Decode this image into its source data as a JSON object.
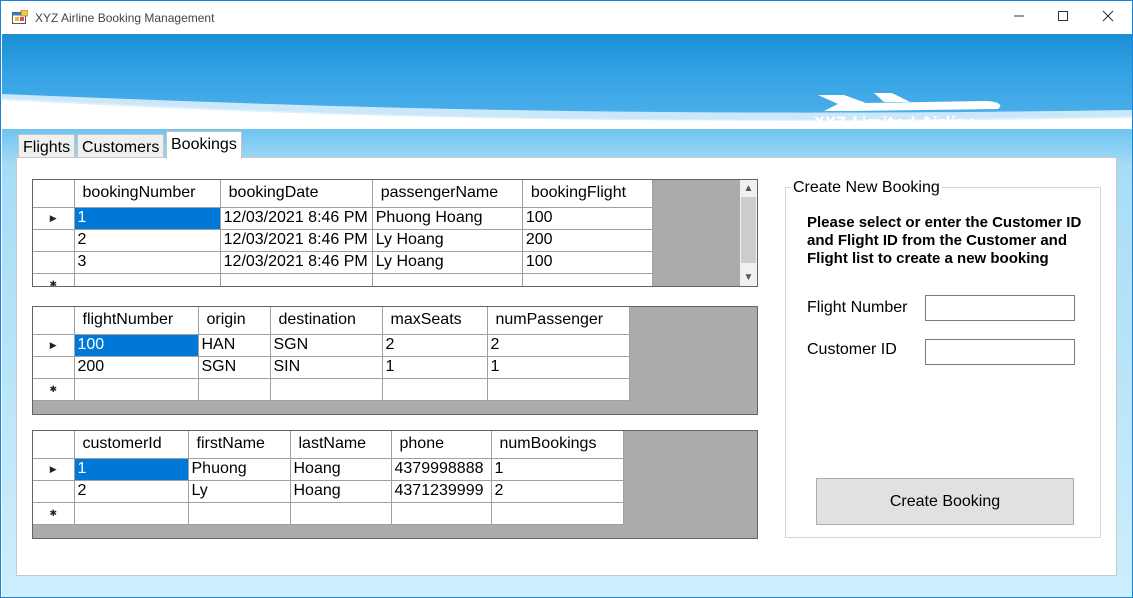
{
  "window": {
    "title": "XYZ Airline Booking Management",
    "controls": {
      "minimize": "—",
      "maximize": "☐",
      "close": "✕"
    }
  },
  "banner": {
    "brand": "XYZ Limited Airline",
    "icon": "airplane-icon"
  },
  "tabs": [
    {
      "label": "Flights",
      "active": false
    },
    {
      "label": "Customers",
      "active": false
    },
    {
      "label": "Bookings",
      "active": true
    }
  ],
  "bookings_grid": {
    "columns": [
      "bookingNumber",
      "bookingDate",
      "passengerName",
      "bookingFlight"
    ],
    "rows": [
      [
        "1",
        "12/03/2021 8:46 PM",
        "Phuong Hoang",
        "100"
      ],
      [
        "2",
        "12/03/2021 8:46 PM",
        "Ly Hoang",
        "200"
      ],
      [
        "3",
        "12/03/2021 8:46 PM",
        "Ly Hoang",
        "100"
      ]
    ],
    "selected_row": 0
  },
  "flights_grid": {
    "columns": [
      "flightNumber",
      "origin",
      "destination",
      "maxSeats",
      "numPassenger"
    ],
    "rows": [
      [
        "100",
        "HAN",
        "SGN",
        "2",
        "2"
      ],
      [
        "200",
        "SGN",
        "SIN",
        "1",
        "1"
      ]
    ],
    "selected_row": 0
  },
  "customers_grid": {
    "columns": [
      "customerId",
      "firstName",
      "lastName",
      "phone",
      "numBookings"
    ],
    "rows": [
      [
        "1",
        "Phuong",
        "Hoang",
        "4379998888",
        "1"
      ],
      [
        "2",
        "Ly",
        "Hoang",
        "4371239999",
        "2"
      ]
    ],
    "selected_row": 0
  },
  "create_booking": {
    "group_title": "Create New Booking",
    "instructions": "Please select or enter the Customer ID and Flight ID from the Customer and Flight list to create a new booking",
    "flight_number_label": "Flight Number",
    "flight_number_value": "",
    "customer_id_label": "Customer ID",
    "customer_id_value": "",
    "button_label": "Create Booking"
  },
  "colors": {
    "selection": "#0078d7",
    "grid_background": "#ababab",
    "banner": "#2b9be0"
  }
}
